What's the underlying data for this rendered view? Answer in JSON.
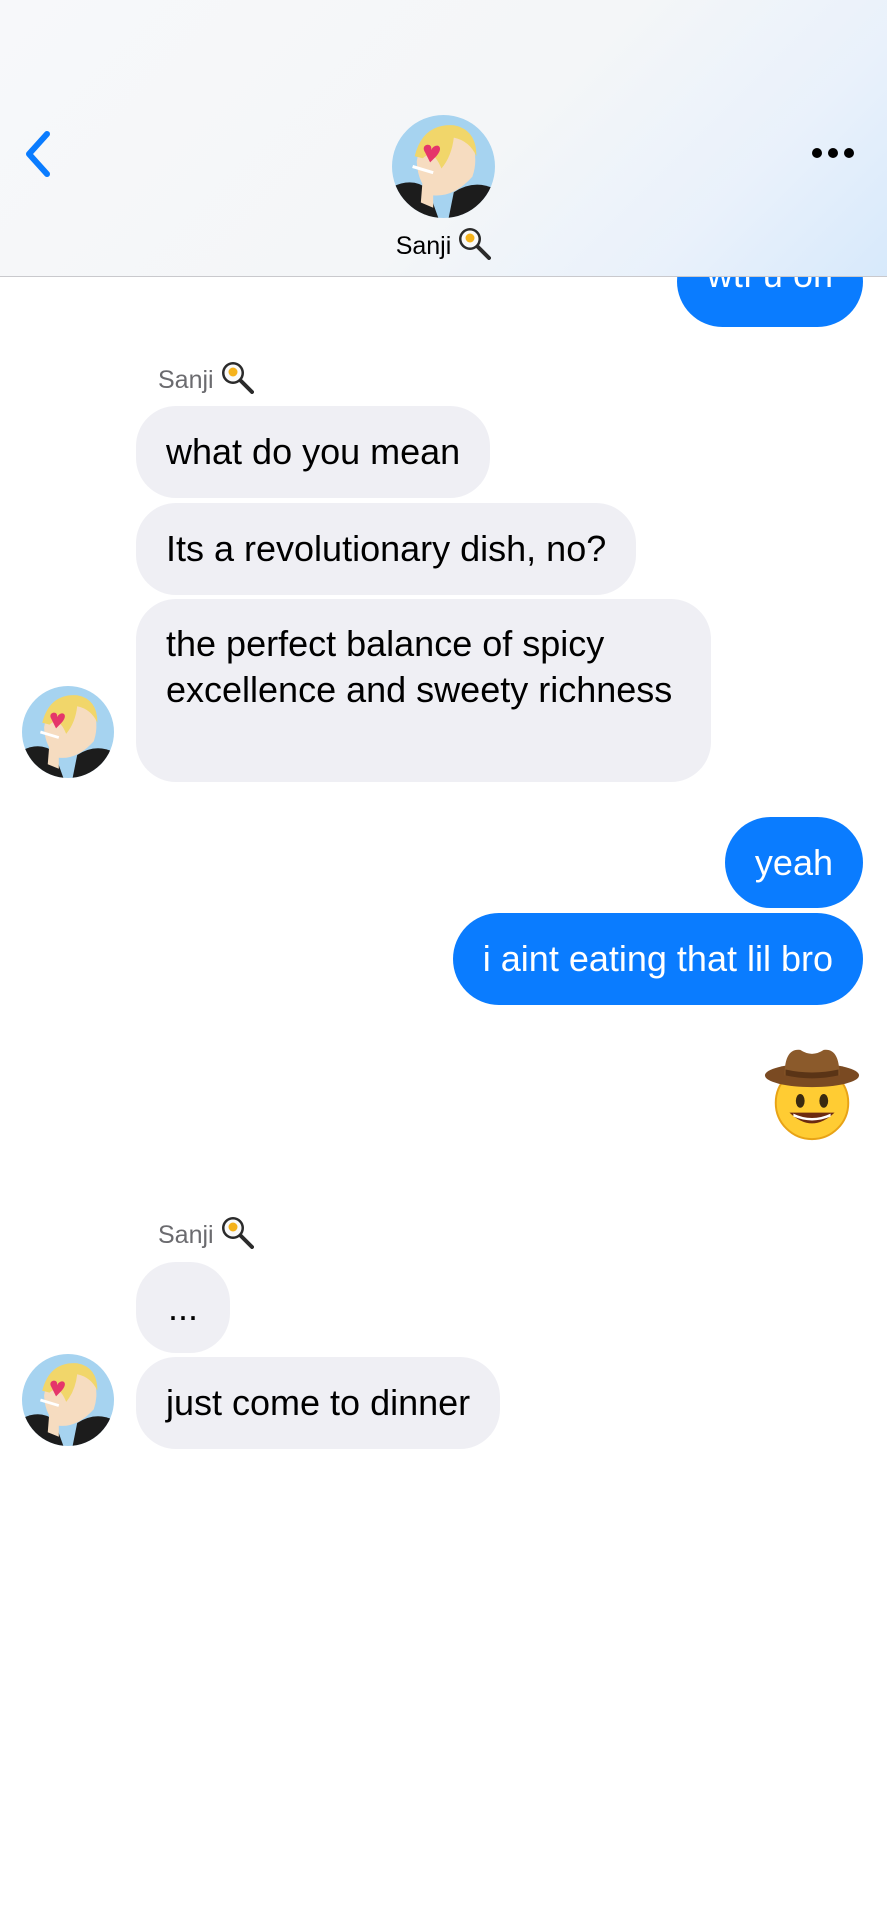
{
  "header": {
    "contact_name": "Sanji",
    "contact_emoji_icon": "frying-pan-egg-icon",
    "back_icon": "chevron-left-icon",
    "more_icon": "ellipsis-icon"
  },
  "colors": {
    "accent": "#0a7cff",
    "incoming_bubble": "#efeff4",
    "sender_label": "#6b6b6f"
  },
  "messages": [
    {
      "direction": "out",
      "text": "wtf u on"
    },
    {
      "direction": "in",
      "sender": "Sanji",
      "text": "what do you mean"
    },
    {
      "direction": "in",
      "text": "Its a revolutionary dish, no?"
    },
    {
      "direction": "in",
      "text": "the perfect balance of spicy excellence and sweety richness"
    },
    {
      "direction": "out",
      "text": "yeah"
    },
    {
      "direction": "out",
      "text": "i aint eating that lil bro"
    },
    {
      "direction": "out",
      "type": "emoji",
      "icon": "cowboy-hat-face-icon"
    },
    {
      "direction": "in",
      "sender": "Sanji",
      "text": "..."
    },
    {
      "direction": "in",
      "text": "just come to dinner"
    }
  ]
}
